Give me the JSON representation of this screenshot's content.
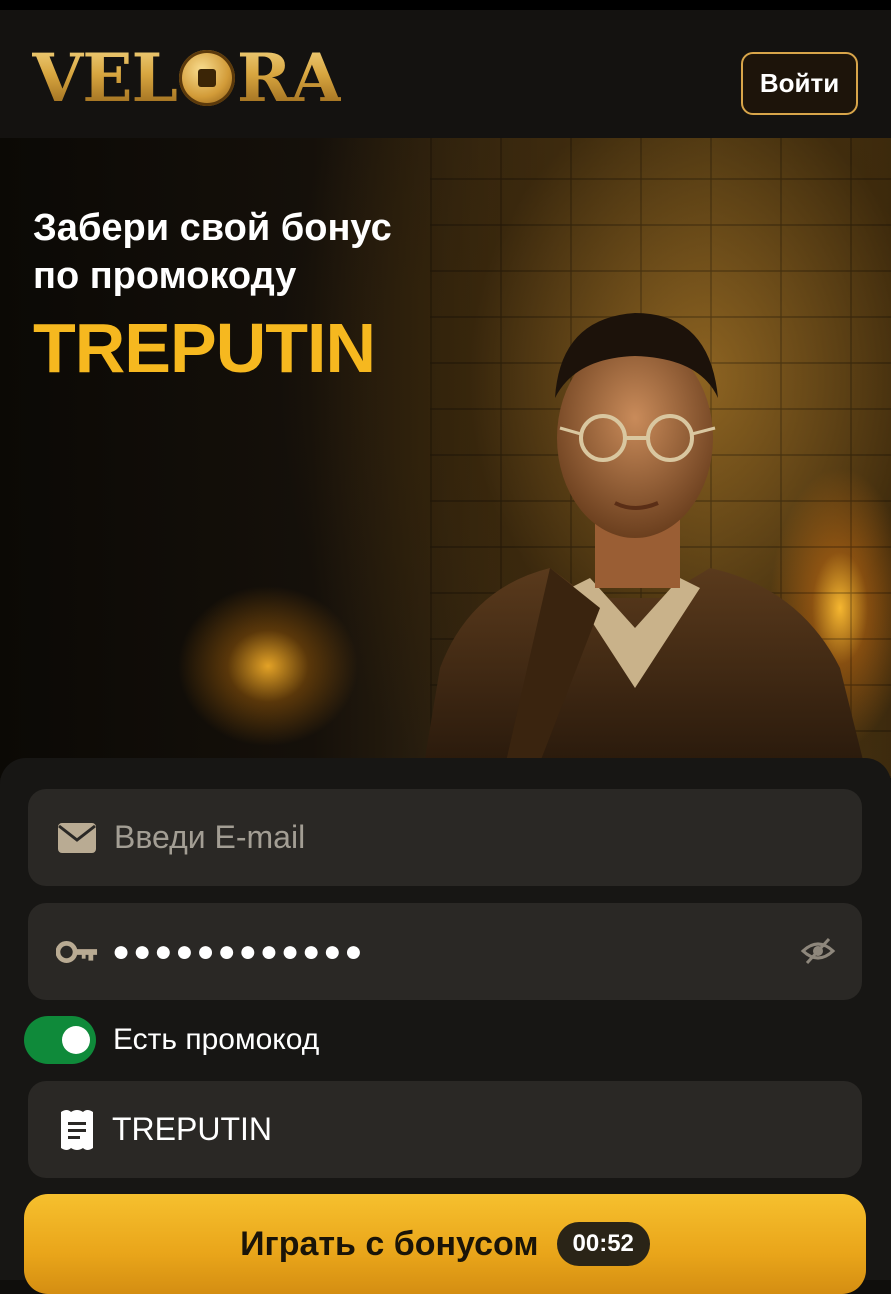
{
  "header": {
    "logo_text_left": "VEL",
    "logo_text_right": "RA",
    "login_label": "Войти"
  },
  "hero": {
    "line1": "Забери свой бонус",
    "line2": "по промокоду",
    "promo_code": "TREPUTIN"
  },
  "form": {
    "email_placeholder": "Введи E-mail",
    "password_masked": "●●●●●●●●●●●●",
    "promo_toggle_label": "Есть промокод",
    "promo_toggle_on": true,
    "promo_value": "TREPUTIN",
    "play_label": "Играть с бонусом",
    "timer": "00:52"
  },
  "colors": {
    "accent": "#f6b81f",
    "toggle_on": "#0f8a3a",
    "field_bg": "#2a2825"
  }
}
